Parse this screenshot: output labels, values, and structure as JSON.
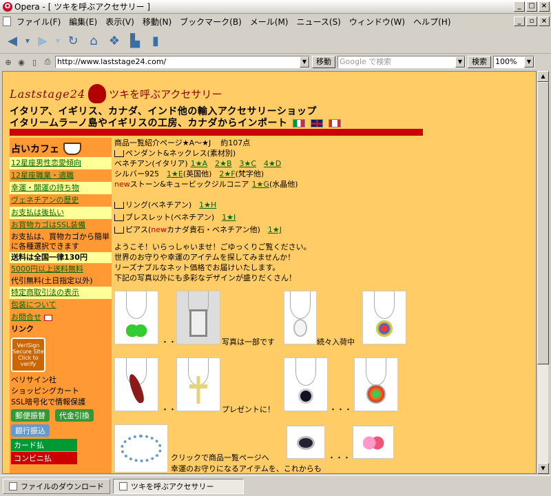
{
  "window": {
    "title": "Opera - [ ツキを呼ぶアクセサリー ]"
  },
  "menu": [
    "ファイル(F)",
    "編集(E)",
    "表示(V)",
    "移動(N)",
    "ブックマーク(B)",
    "メール(M)",
    "ニュース(S)",
    "ウィンドウ(W)",
    "ヘルプ(H)"
  ],
  "address": {
    "url": "http://www.laststage24.com/",
    "go": "移動",
    "search_placeholder": "Google で検索",
    "search_btn": "検索",
    "zoom": "100%"
  },
  "header": {
    "logo": "Laststage24",
    "logo_sub": "ツキを呼ぶアクセサリー",
    "line1": "イタリア、イギリス、カナダ、インド他の輸入アクセサリーショップ",
    "line2": "イタリームラーノ島やイギリスの工房、カナダからインポート"
  },
  "sidebar": {
    "heading": "占いカフェ",
    "links": [
      "12星座男性恋愛傾向",
      "12星座職業・適職",
      "幸運・開運の持ち物",
      "ヴェネチアンの歴史",
      "お支払は後払い",
      "お買物カゴはSSL装備"
    ],
    "note1": "お支払は、買物カゴから簡単に各種選択できます",
    "note2": "送料は全国一律130円",
    "link7": "5000円以上送料無料",
    "note3": "代引無料(土日指定以外)",
    "link8": "特定商取引法の表示",
    "link9": "包装について",
    "link10": "お問合せ",
    "link_label": "リンク",
    "verisign": "VeriSign Secure Site Click to verify",
    "verisign_text": "ベリサイン社",
    "cart_text": "ショッピングカート",
    "ssl_text": "SSL暗号化で情報保護",
    "pay1": "郵便振替",
    "pay2": "代金引換",
    "pay3": "銀行振込",
    "pay4": "カード払",
    "pay5": "コンビニ払"
  },
  "main": {
    "intro": "商品一覧紹介ページ★A～★J",
    "count": "約107点",
    "cat1": "ペンダント&ネックレス(素材別)",
    "venetian": "ベネチアン(イタリア)",
    "v_links": [
      "1★A",
      "2★B",
      "3★C",
      "4★D"
    ],
    "silver": "シルバー925",
    "s1": "1★E",
    "s1b": "(英国他)",
    "s2": "2★F",
    "s2b": "(梵字他)",
    "new": "new",
    "stone": "ストーン&キュービックジルコニア",
    "st1": "1★G",
    "st1b": "(水晶他)",
    "ring": "リング(ベネチアン)",
    "ring_l": "1★H",
    "bracelet": "ブレスレット(ベネチアン)",
    "br_l": "1★I",
    "pierce": "ピアス(",
    "pierce_new": "new",
    "pierce2": "カナダ貴石・ベネチアン他)",
    "pi_l": "1★J",
    "welcome1": "ようこそ！いらっしゃいませ！ごゆっくりご覧ください。",
    "welcome2": "世界のお守りや幸運のアイテムを探してみませんか！",
    "welcome3": "リーズナブルなネット価格でお届けいたします。",
    "welcome4": "下記の写真以外にも多彩なデザインが盛りだくさん！",
    "photo_t1": "写真は一部です",
    "photo_t2": "続々入荷中",
    "photo_t3": "プレゼントに！",
    "photo_t4": "クリックで商品一覧ページへ",
    "photo_t5": "幸運のお守りになるアイテムを、これからも",
    "dots": "・・",
    "dots3": "・・・"
  },
  "status": {
    "downloads": "ファイルのダウンロード",
    "tab": "ツキを呼ぶアクセサリー"
  }
}
